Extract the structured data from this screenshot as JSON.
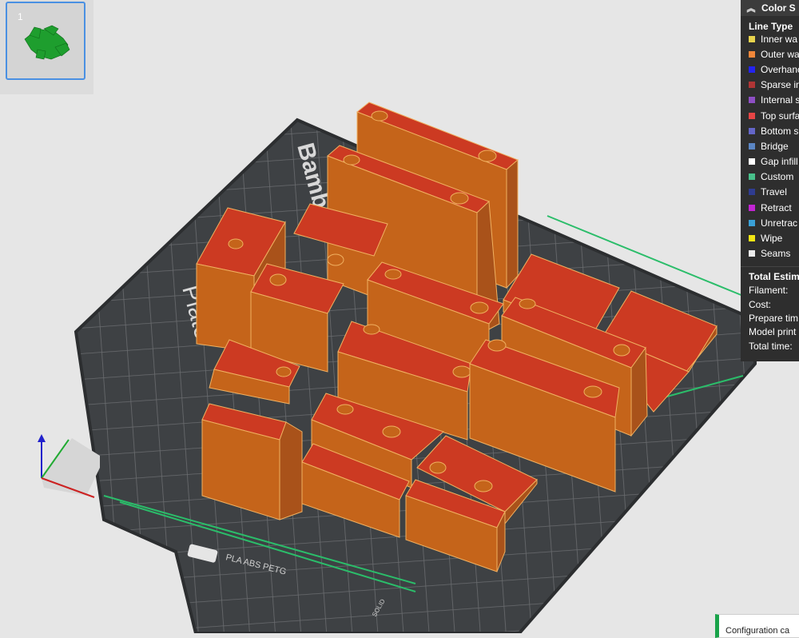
{
  "plate": {
    "number": "1",
    "brand_text": "Bambu",
    "plate_text": "Plate",
    "material_text": "PLA ABS PETG",
    "corner_text": "SOLID"
  },
  "legend": {
    "header": "Color S",
    "line_type_title": "Line Type",
    "line_types": [
      {
        "label": "Inner wa",
        "color": "#e8d44d"
      },
      {
        "label": "Outer wa",
        "color": "#f0873a"
      },
      {
        "label": "Overhanc",
        "color": "#2424f0"
      },
      {
        "label": "Sparse in",
        "color": "#b03535"
      },
      {
        "label": "Internal s",
        "color": "#8e4fc4"
      },
      {
        "label": "Top surfa",
        "color": "#e64545"
      },
      {
        "label": "Bottom s",
        "color": "#6466c8"
      },
      {
        "label": "Bridge",
        "color": "#5b86c4"
      },
      {
        "label": "Gap infill",
        "color": "#ffffff"
      },
      {
        "label": "Custom",
        "color": "#48c08a"
      },
      {
        "label": "Travel",
        "color": "#2f3c90"
      },
      {
        "label": "Retract",
        "color": "#c225d3"
      },
      {
        "label": "Unretrac",
        "color": "#3aa0d6"
      },
      {
        "label": "Wipe",
        "color": "#f2e614"
      },
      {
        "label": "Seams",
        "color": "#ececec"
      }
    ],
    "estimate_title": "Total Estim",
    "estimates": [
      {
        "label": "Filament:"
      },
      {
        "label": "Cost:"
      },
      {
        "label": "Prepare tim"
      },
      {
        "label": "Model print"
      },
      {
        "label": "Total time:"
      }
    ]
  },
  "notification": {
    "text": "Configuration ca",
    "accent": "#19a34a"
  },
  "colors": {
    "part_side": "#c5641a",
    "part_top": "#cc3a22",
    "thumbnail_model": "#1e9e2e",
    "bed": "#3e4144",
    "grid": "#6a6c6f"
  }
}
